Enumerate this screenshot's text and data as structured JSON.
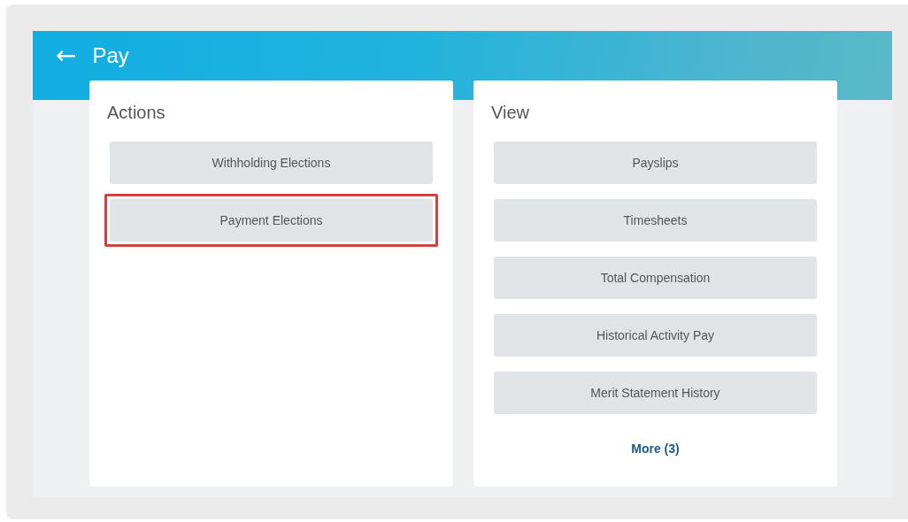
{
  "header": {
    "back": "←",
    "title": "Pay"
  },
  "cards": [
    {
      "title": "Actions",
      "buttons": [
        {
          "label": "Withholding Elections",
          "highlighted": false
        },
        {
          "label": "Payment Elections",
          "highlighted": true
        }
      ]
    },
    {
      "title": "View",
      "buttons": [
        {
          "label": "Payslips",
          "highlighted": false
        },
        {
          "label": "Timesheets",
          "highlighted": false
        },
        {
          "label": "Total Compensation",
          "highlighted": false
        },
        {
          "label": "Historical Activity Pay",
          "highlighted": false
        },
        {
          "label": "Merit Statement History",
          "highlighted": false
        }
      ],
      "more_link": "More (3)"
    }
  ]
}
